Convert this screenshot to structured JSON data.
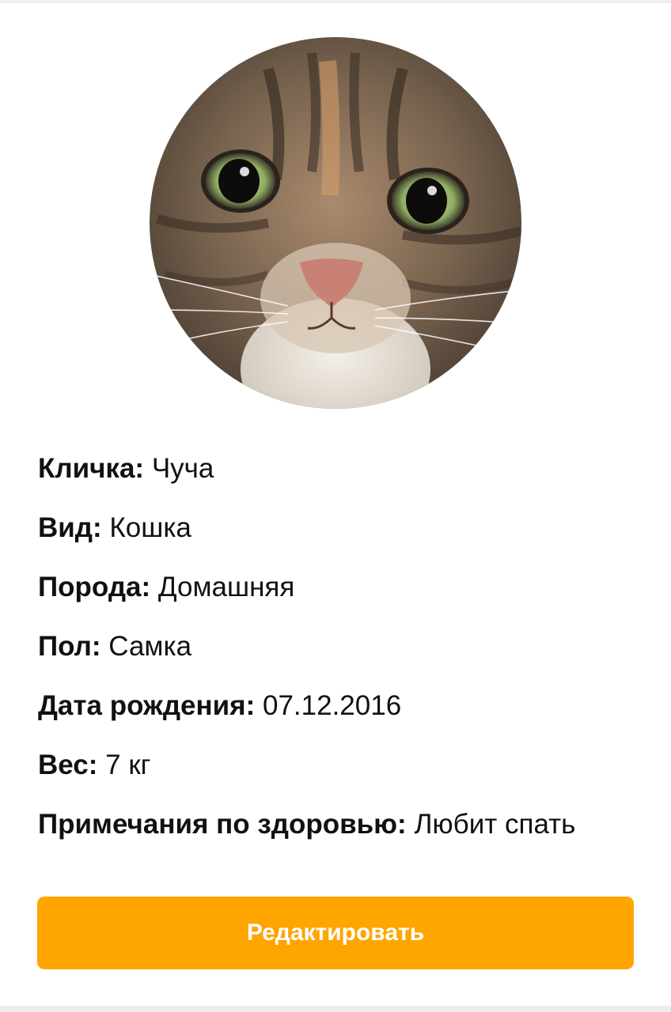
{
  "pet_profile": {
    "photo": {
      "subject": "tabby cat face photo"
    },
    "fields": [
      {
        "label": "Кличка:",
        "value": "Чуча"
      },
      {
        "label": "Вид:",
        "value": "Кошка"
      },
      {
        "label": "Порода:",
        "value": "Домашняя"
      },
      {
        "label": "Пол:",
        "value": "Самка"
      },
      {
        "label": "Дата рождения:",
        "value": "07.12.2016"
      },
      {
        "label": "Вес:",
        "value": "7 кг"
      },
      {
        "label": "Примечания по здоровью:",
        "value": "Любит спать"
      }
    ],
    "edit_button_label": "Редактировать"
  },
  "colors": {
    "accent": "#FFA500",
    "text": "#111111",
    "background": "#FFFFFF"
  }
}
